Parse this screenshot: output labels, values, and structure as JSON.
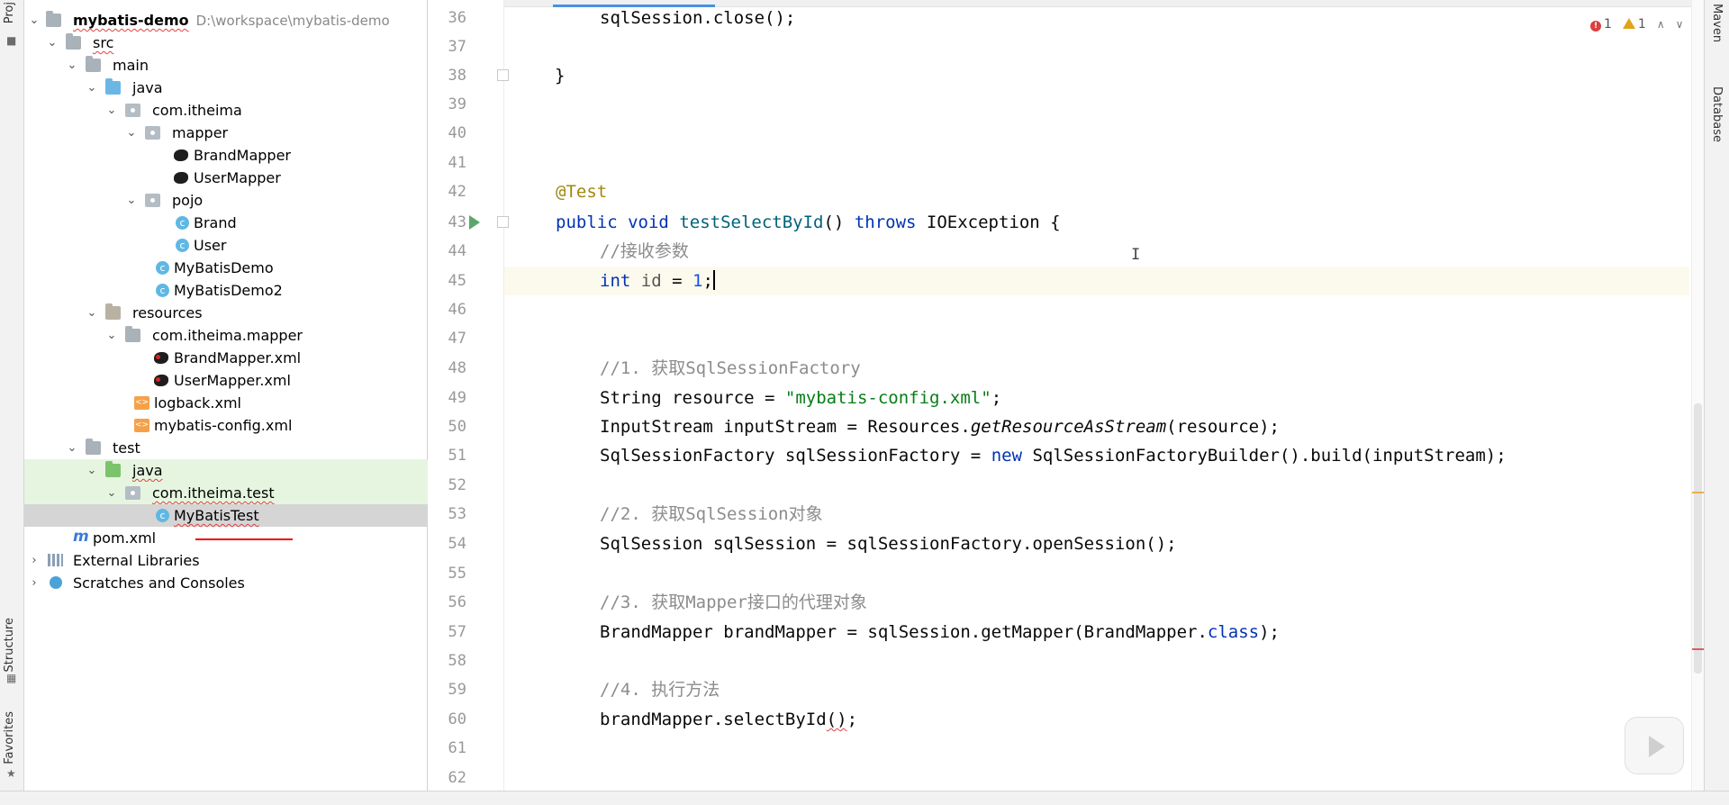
{
  "left_strip": {
    "tabs": [
      "Proj",
      "Structure",
      "Favorites"
    ]
  },
  "right_strip": {
    "tabs": [
      "Maven",
      "Database"
    ]
  },
  "project_tree": {
    "root_name": "mybatis-demo",
    "root_path": "D:\\workspace\\mybatis-demo",
    "items": [
      {
        "label": "src",
        "icon": "folder-icon"
      },
      {
        "label": "main",
        "icon": "folder-icon"
      },
      {
        "label": "java",
        "icon": "source-folder-icon"
      },
      {
        "label": "com.itheima",
        "icon": "package-icon"
      },
      {
        "label": "mapper",
        "icon": "package-icon"
      },
      {
        "label": "BrandMapper",
        "icon": "mybatis-mapper-icon"
      },
      {
        "label": "UserMapper",
        "icon": "mybatis-mapper-icon"
      },
      {
        "label": "pojo",
        "icon": "package-icon"
      },
      {
        "label": "Brand",
        "icon": "class-icon"
      },
      {
        "label": "User",
        "icon": "class-icon"
      },
      {
        "label": "MyBatisDemo",
        "icon": "runnable-class-icon"
      },
      {
        "label": "MyBatisDemo2",
        "icon": "runnable-class-icon"
      },
      {
        "label": "resources",
        "icon": "resources-folder-icon"
      },
      {
        "label": "com.itheima.mapper",
        "icon": "folder-icon"
      },
      {
        "label": "BrandMapper.xml",
        "icon": "mybatis-xml-icon"
      },
      {
        "label": "UserMapper.xml",
        "icon": "mybatis-xml-icon"
      },
      {
        "label": "logback.xml",
        "icon": "xml-file-icon"
      },
      {
        "label": "mybatis-config.xml",
        "icon": "xml-file-icon"
      },
      {
        "label": "test",
        "icon": "folder-icon"
      },
      {
        "label": "java",
        "icon": "test-source-folder-icon"
      },
      {
        "label": "com.itheima.test",
        "icon": "package-icon"
      },
      {
        "label": "MyBatisTest",
        "icon": "runnable-class-icon"
      },
      {
        "label": "pom.xml",
        "icon": "maven-pom-icon"
      },
      {
        "label": "External Libraries",
        "icon": "library-icon"
      },
      {
        "label": "Scratches and Consoles",
        "icon": "scratch-icon"
      }
    ]
  },
  "inspection": {
    "errors": "1",
    "warnings": "1"
  },
  "editor": {
    "line_numbers": [
      "36",
      "37",
      "38",
      "39",
      "40",
      "41",
      "42",
      "43",
      "44",
      "45",
      "46",
      "47",
      "48",
      "49",
      "50",
      "51",
      "52",
      "53",
      "54",
      "55",
      "56",
      "57",
      "58",
      "59",
      "60",
      "61",
      "62"
    ],
    "code": {
      "l36": "sqlSession.close();",
      "l38": "}",
      "l42": "@Test",
      "l43_kw1": "public",
      "l43_kw2": "void",
      "l43_name": "testSelectById",
      "l43_paren": "()",
      "l43_throws": "throws",
      "l43_exc": "IOException {",
      "l44": "//接收参数",
      "l45_kw": "int",
      "l45_var": "id",
      "l45_eq": " = ",
      "l45_num": "1",
      "l45_semi": ";",
      "l48": "//1. 获取SqlSessionFactory",
      "l49_a": "String resource = ",
      "l49_str": "\"mybatis-config.xml\"",
      "l49_b": ";",
      "l50_a": "InputStream inputStream = Resources.",
      "l50_it": "getResourceAsStream",
      "l50_b": "(resource);",
      "l51_a": "SqlSessionFactory sqlSessionFactory = ",
      "l51_new": "new",
      "l51_b": " SqlSessionFactoryBuilder().build(inputStream);",
      "l53": "//2. 获取SqlSession对象",
      "l54": "SqlSession sqlSession = sqlSessionFactory.openSession();",
      "l56": "//3. 获取Mapper接口的代理对象",
      "l57_a": "BrandMapper brandMapper = sqlSession.getMapper(BrandMapper.",
      "l57_cls": "class",
      "l57_b": ");",
      "l59": "//4. 执行方法",
      "l60_a": "brandMapper.selectById",
      "l60_b": "()",
      "l60_c": ";"
    }
  },
  "colors": {
    "keyword": "#0033b3",
    "annotation": "#9e880d",
    "method": "#00627a",
    "comment": "#8c8c8c",
    "string": "#067d17",
    "number": "#1750eb",
    "selection": "#d5d5d5",
    "test_folder_highlight": "#e6f5e0"
  }
}
